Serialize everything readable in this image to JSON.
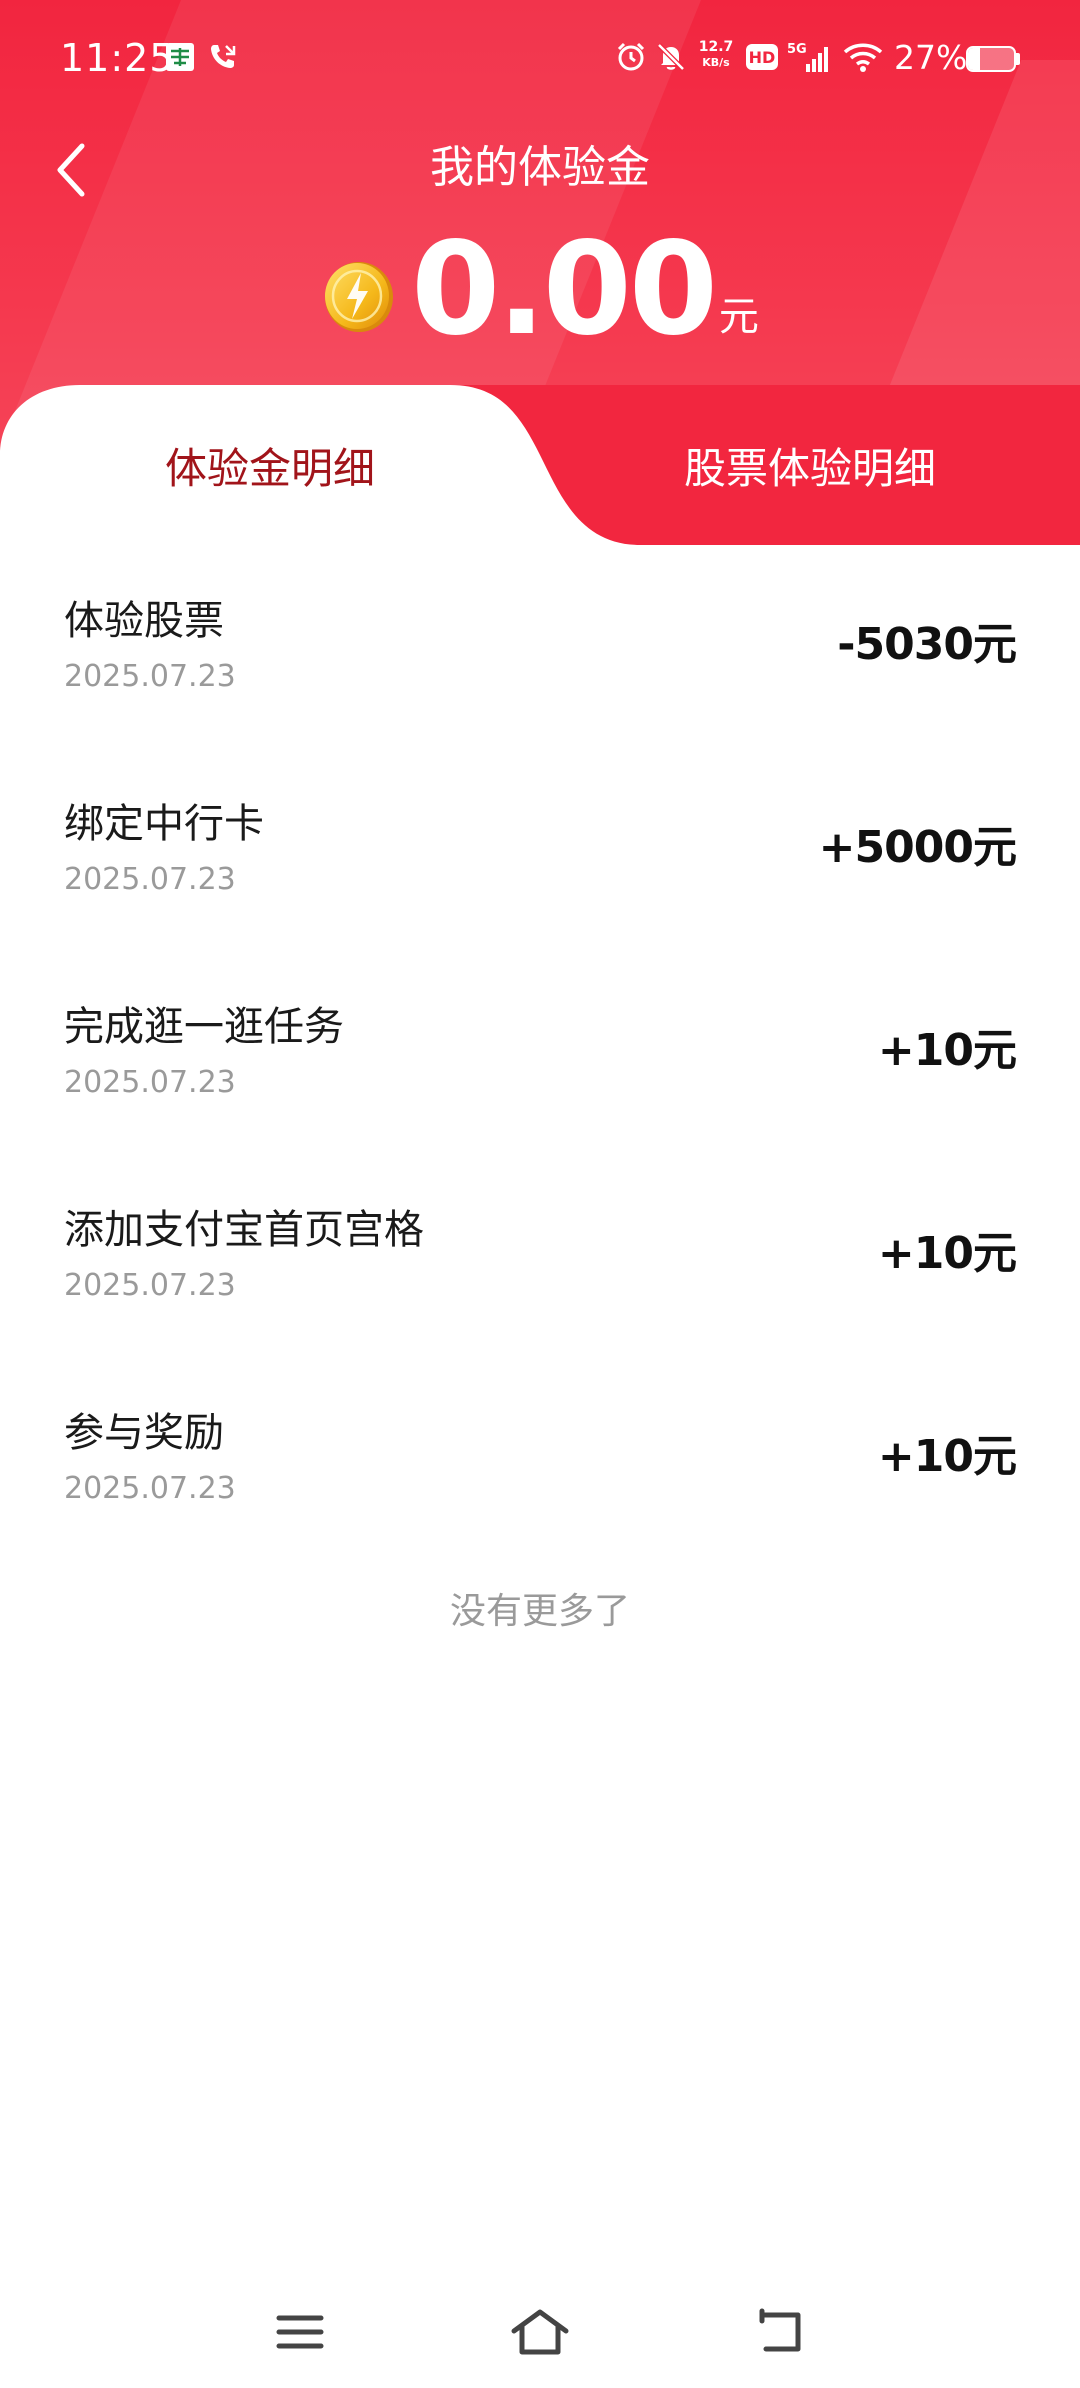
{
  "status_bar": {
    "time": "11:25",
    "net_speed_value": "12.7",
    "net_speed_unit": "KB/s",
    "hd_label": "HD",
    "network_label": "5G",
    "battery_text": "27%",
    "battery_level": 0.27,
    "icons": [
      "china-post-icon",
      "phone-call-icon",
      "alarm-icon",
      "bell-muted-icon",
      "signal-icon",
      "wifi-icon",
      "battery-icon"
    ]
  },
  "header": {
    "title": "我的体验金",
    "back_icon": "chevron-left-icon"
  },
  "balance": {
    "amount": "0.00",
    "unit": "元",
    "icon": "gold-coin-lightning-icon"
  },
  "tabs": [
    {
      "label": "体验金明细",
      "active": true
    },
    {
      "label": "股票体验明细",
      "active": false
    }
  ],
  "records": [
    {
      "title": "体验股票",
      "date": "2025.07.23",
      "amount": "-5030元"
    },
    {
      "title": "绑定中行卡",
      "date": "2025.07.23",
      "amount": "+5000元"
    },
    {
      "title": "完成逛一逛任务",
      "date": "2025.07.23",
      "amount": "+10元"
    },
    {
      "title": "添加支付宝首页宫格",
      "date": "2025.07.23",
      "amount": "+10元"
    },
    {
      "title": "参与奖励",
      "date": "2025.07.23",
      "amount": "+10元"
    }
  ],
  "footer": {
    "no_more_text": "没有更多了"
  },
  "nav_bar": {
    "buttons": [
      "menu-icon",
      "home-icon",
      "back-icon"
    ]
  },
  "colors": {
    "brand_red": "#f2253f",
    "active_tab_text": "#a1141a",
    "coin_gold": "#f5b81a"
  }
}
